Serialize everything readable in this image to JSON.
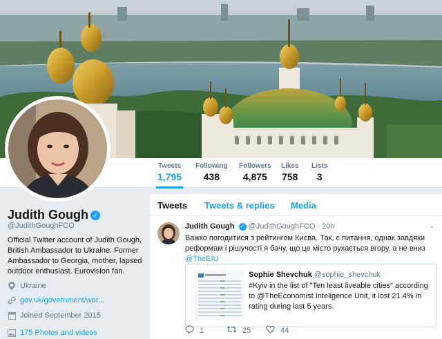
{
  "stats": [
    {
      "label": "Tweets",
      "value": "1,795"
    },
    {
      "label": "Following",
      "value": "438"
    },
    {
      "label": "Followers",
      "value": "4,875"
    },
    {
      "label": "Likes",
      "value": "758"
    },
    {
      "label": "Lists",
      "value": "3"
    }
  ],
  "profile": {
    "name": "Judith Gough",
    "handle": "@JudithGoughFCO",
    "bio": "Official Twitter account of Judith Gough, British Ambassador to Ukraine. Former Ambassador to Georgia, mother, lapsed outdoor enthusiast. Eurovision fan.",
    "location": "Ukraine",
    "website": "gov.uk/government/wor...",
    "joined": "Joined September 2015",
    "media": "175 Photos and videos"
  },
  "tabs": [
    "Tweets",
    "Tweets & replies",
    "Media"
  ],
  "tweet": {
    "name": "Judith Gough",
    "handle": "@JudithGoughFCO",
    "time": "· 20h",
    "text": "Важко погодитися з рейтингом Києва. Так, є питання, однак завдяки реформам і рішучості я бачу, що це місто рухається вгору, а не вниз",
    "mention": "@TheEIU",
    "quote": {
      "name": "Sophie Shevchuk",
      "handle": "@sophie_shevchuk",
      "text": "#Kyiv in the list of \"Ten least liveable cities\" according to @TheEconomist Inteligence Unit, it lost 21.4% in rating during last 5 years."
    },
    "replies": "1",
    "retweets": "25",
    "likes": "44"
  },
  "colors": {
    "accent": "#1da1f2",
    "verified": "#1da1f2",
    "background": "#e6ecf0"
  }
}
